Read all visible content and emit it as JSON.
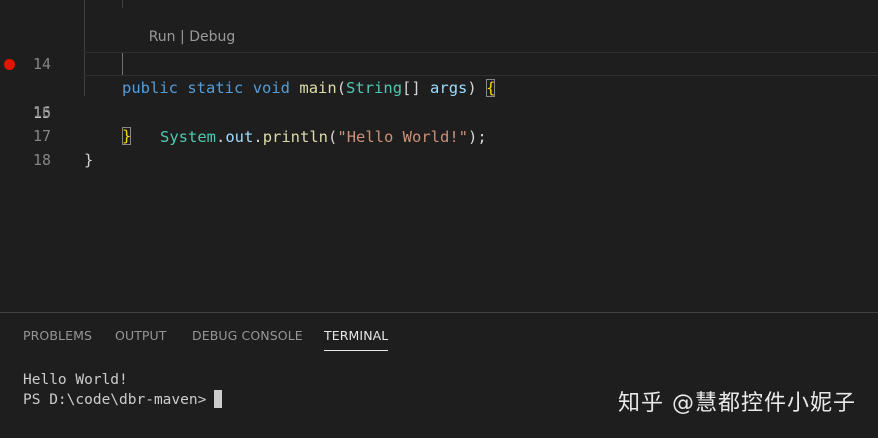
{
  "editor": {
    "codelens": {
      "run": "Run",
      "separator": " | ",
      "debug": "Debug"
    },
    "lines": [
      {
        "number": "14",
        "tokens": [
          "public",
          "static",
          "void",
          "main",
          "(",
          "String",
          "[]",
          "args",
          ")",
          "{"
        ]
      },
      {
        "number": "15",
        "breakpoint": true,
        "tokens": [
          "System",
          ".",
          "out",
          ".",
          "println",
          "(",
          "\"Hello World!\"",
          ");"
        ]
      },
      {
        "number": "16",
        "tokens": [
          "}"
        ]
      },
      {
        "number": "17",
        "tokens": [
          "}"
        ]
      },
      {
        "number": "18",
        "tokens": []
      }
    ]
  },
  "panel": {
    "tabs": [
      {
        "label": "PROBLEMS",
        "active": false
      },
      {
        "label": "OUTPUT",
        "active": false
      },
      {
        "label": "DEBUG CONSOLE",
        "active": false
      },
      {
        "label": "TERMINAL",
        "active": true
      }
    ],
    "terminal": {
      "output_line": "Hello World!",
      "prompt": "PS D:\\code\\dbr-maven>"
    }
  },
  "watermark": "知乎 @慧都控件小妮子",
  "colors": {
    "background": "#1e1e1e",
    "keyword": "#569cd6",
    "function": "#dcdcaa",
    "type": "#4ec9b0",
    "variable": "#9cdcfe",
    "string": "#ce9178",
    "breakpoint": "#e51400"
  }
}
